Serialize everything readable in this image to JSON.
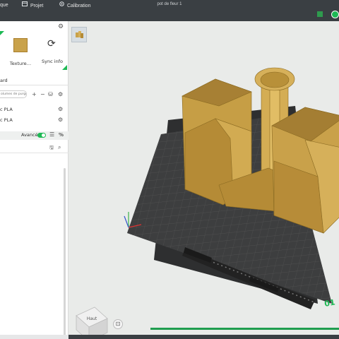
{
  "titlebar": {
    "tabs": [
      {
        "label": "que",
        "icon": "prepare-icon"
      },
      {
        "label": "Projet",
        "icon": "project-icon"
      },
      {
        "label": "Calibration",
        "icon": "calibration-icon"
      }
    ],
    "document_title": "pot de fleur 1"
  },
  "left_panel": {
    "texture_label": "Texture…",
    "sync_label": "Sync info",
    "plate_type_value": "ard",
    "purge_placeholder": "olumes de purge",
    "filaments": [
      {
        "label": "c PLA"
      },
      {
        "label": "c PLA"
      }
    ],
    "advanced_label": "Avancé",
    "advanced_on": true,
    "percent_symbol": "%"
  },
  "viewport": {
    "view_cube_label": "Haut",
    "plate_label": "01",
    "slice_progress": 1.0
  },
  "colors": {
    "accent": "#1db954",
    "titlebar": "#3a3f43",
    "filament": "#c9a24b",
    "plate": "#3a3b3c"
  }
}
